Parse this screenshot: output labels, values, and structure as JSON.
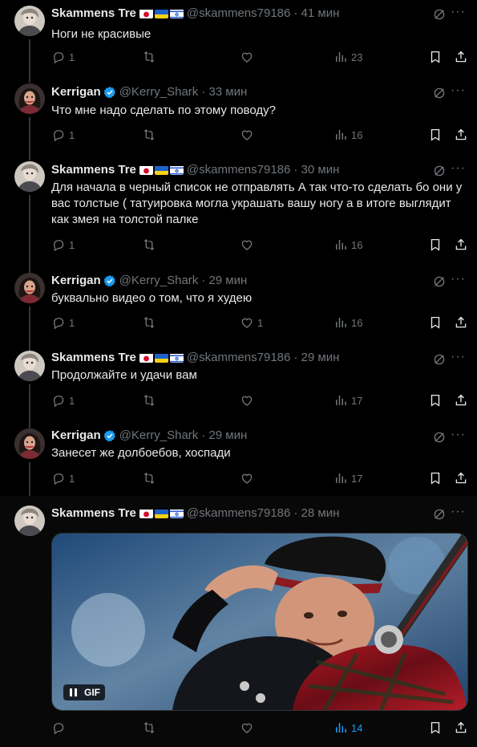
{
  "tweets": [
    {
      "author": "Skammens Tre",
      "flags": [
        "japan-flag",
        "ukraine-flag",
        "israel-flag"
      ],
      "verified": false,
      "handle": "@skammens79186",
      "time": "· 41 мин",
      "text": "Ноги не красивые",
      "replies": "1",
      "reposts": "",
      "likes": "",
      "views": "23"
    },
    {
      "author": "Kerrigan",
      "flags": [],
      "verified": true,
      "handle": "@Kerry_Shark",
      "time": "· 33 мин",
      "text": "Что мне надо сделать по этому поводу?",
      "replies": "1",
      "reposts": "",
      "likes": "",
      "views": "16"
    },
    {
      "author": "Skammens Tre",
      "flags": [
        "japan-flag",
        "ukraine-flag",
        "israel-flag"
      ],
      "verified": false,
      "handle": "@skammens79186",
      "time": "· 30 мин",
      "text": "Для начала в черный список не отправлять А  так что-то сделать бо они у вас толстые ( татуировка могла украшать вашу ногу а в итоге выглядит как змея на толстой палке",
      "replies": "1",
      "reposts": "",
      "likes": "",
      "views": "16"
    },
    {
      "author": "Kerrigan",
      "flags": [],
      "verified": true,
      "handle": "@Kerry_Shark",
      "time": "· 29 мин",
      "text": "буквально видео о том, что я худею",
      "replies": "1",
      "reposts": "",
      "likes": "1",
      "views": "16"
    },
    {
      "author": "Skammens Tre",
      "flags": [
        "japan-flag",
        "ukraine-flag",
        "israel-flag"
      ],
      "verified": false,
      "handle": "@skammens79186",
      "time": "· 29 мин",
      "text": "Продолжайте и удачи вам",
      "replies": "1",
      "reposts": "",
      "likes": "",
      "views": "17"
    },
    {
      "author": "Kerrigan",
      "flags": [],
      "verified": true,
      "handle": "@Kerry_Shark",
      "time": "· 29 мин",
      "text": "Занесет же долбоебов, хоспади",
      "replies": "1",
      "reposts": "",
      "likes": "",
      "views": "17"
    },
    {
      "author": "Skammens Tre",
      "flags": [
        "japan-flag",
        "ukraine-flag",
        "israel-flag"
      ],
      "verified": false,
      "handle": "@skammens79186",
      "time": "· 28 мин",
      "text": "",
      "media_label": "GIF",
      "replies": "",
      "reposts": "",
      "likes": "",
      "views": "14"
    }
  ],
  "colors": {
    "background": "#000000",
    "text": "#e7e9ea",
    "muted": "#71767b",
    "verified": "#1d9bf0",
    "views_accent": "#1d9bf0"
  },
  "icons": {
    "reply": "reply-icon",
    "repost": "repost-icon",
    "like": "heart-icon",
    "views": "views-icon",
    "bookmark": "bookmark-icon",
    "share": "share-icon",
    "grok": "grok-icon",
    "more": "more-icon"
  }
}
